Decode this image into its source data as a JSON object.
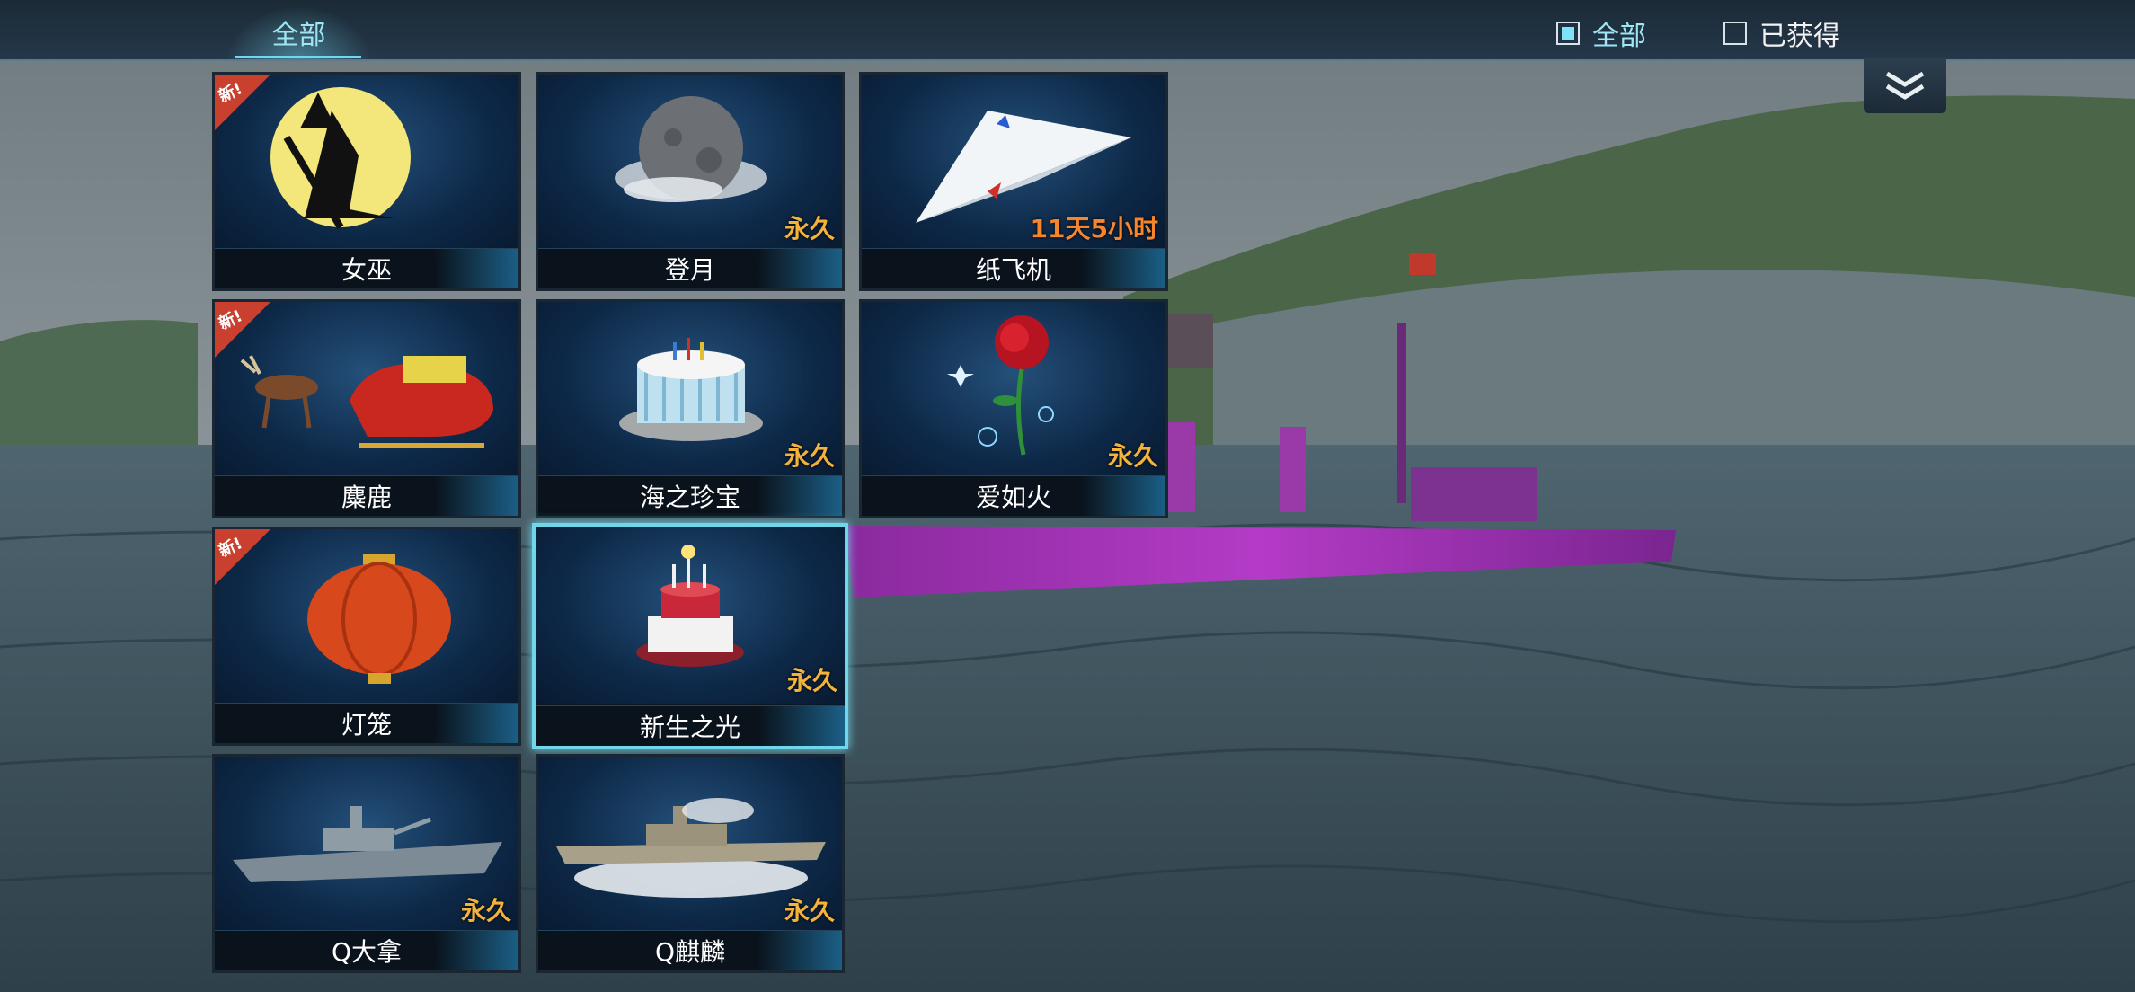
{
  "tabs": {
    "active": "全部"
  },
  "filters": [
    {
      "label": "全部",
      "checked": true
    },
    {
      "label": "已获得",
      "checked": false
    }
  ],
  "items": [
    {
      "name": "女巫",
      "duration": "",
      "new": "新!",
      "icon": "witch-moon-icon"
    },
    {
      "name": "登月",
      "duration": "永久",
      "new": "",
      "icon": "moon-icon"
    },
    {
      "name": "纸飞机",
      "duration": "11天5小时",
      "new": "",
      "icon": "paper-plane-icon"
    },
    {
      "name": "麋鹿",
      "duration": "",
      "new": "新!",
      "icon": "reindeer-sleigh-icon"
    },
    {
      "name": "海之珍宝",
      "duration": "永久",
      "new": "",
      "icon": "cake-icon"
    },
    {
      "name": "爱如火",
      "duration": "永久",
      "new": "",
      "icon": "rose-icon"
    },
    {
      "name": "灯笼",
      "duration": "",
      "new": "新!",
      "icon": "lantern-icon"
    },
    {
      "name": "新生之光",
      "duration": "永久",
      "new": "",
      "icon": "birthday-cake-icon"
    },
    {
      "name": "Q大拿",
      "duration": "永久",
      "new": "",
      "icon": "battleship-icon"
    },
    {
      "name": "Q麒麟",
      "duration": "永久",
      "new": "",
      "icon": "destroyer-icon"
    }
  ],
  "selected_item": "新生之光"
}
